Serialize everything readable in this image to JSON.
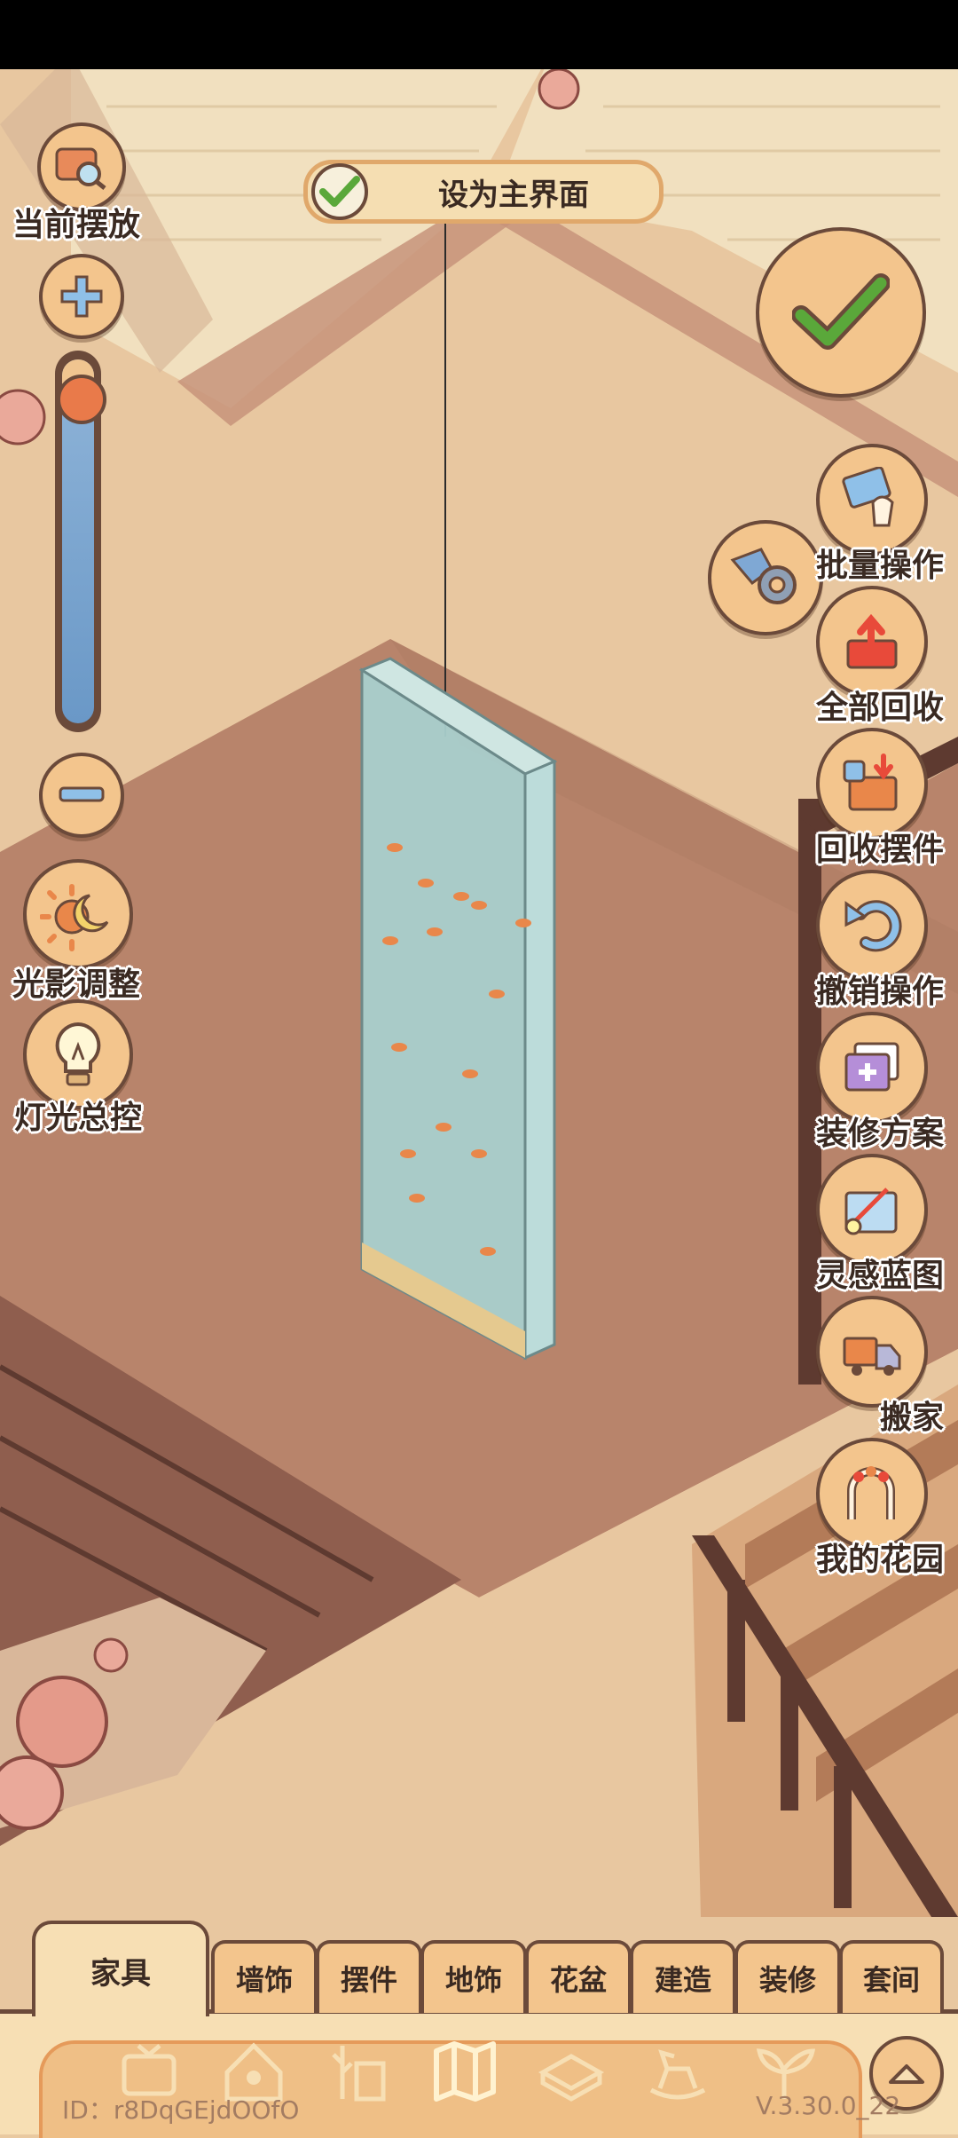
{
  "set_main": {
    "label": "设为主界面"
  },
  "left_controls": {
    "current_placement": "当前摆放",
    "lighting_adjust": "光影调整",
    "light_control": "灯光总控"
  },
  "zoom_slider": {
    "level": 0.1
  },
  "right_menu": [
    {
      "label": "批量操作",
      "icon": "batch-hand-icon"
    },
    {
      "label": "全部回收",
      "icon": "recycle-all-icon"
    },
    {
      "label": "回收摆件",
      "icon": "recycle-box-icon"
    },
    {
      "label": "撤销操作",
      "icon": "undo-icon"
    },
    {
      "label": "装修方案",
      "icon": "decor-plan-icon"
    },
    {
      "label": "灵感蓝图",
      "icon": "blueprint-icon"
    },
    {
      "label": "搬家",
      "icon": "truck-icon"
    },
    {
      "label": "我的花园",
      "icon": "garden-arch-icon"
    }
  ],
  "tabs": [
    {
      "label": "家具",
      "active": true
    },
    {
      "label": "墙饰"
    },
    {
      "label": "摆件"
    },
    {
      "label": "地饰"
    },
    {
      "label": "花盆"
    },
    {
      "label": "建造"
    },
    {
      "label": "装修"
    },
    {
      "label": "套间"
    }
  ],
  "category_icons": [
    "tv-icon",
    "pet-house-icon",
    "plant-stand-icon",
    "map-icon",
    "bed-icon",
    "rocking-horse-icon",
    "sprout-icon"
  ],
  "footer": {
    "id": "ID：r8DqGEjdOOfO",
    "version": "V.3.30.0_22"
  },
  "colors": {
    "outline": "#6b4a3a",
    "button": "#f3c58d",
    "accent": "#e97a4a",
    "check": "#5aa83a"
  }
}
